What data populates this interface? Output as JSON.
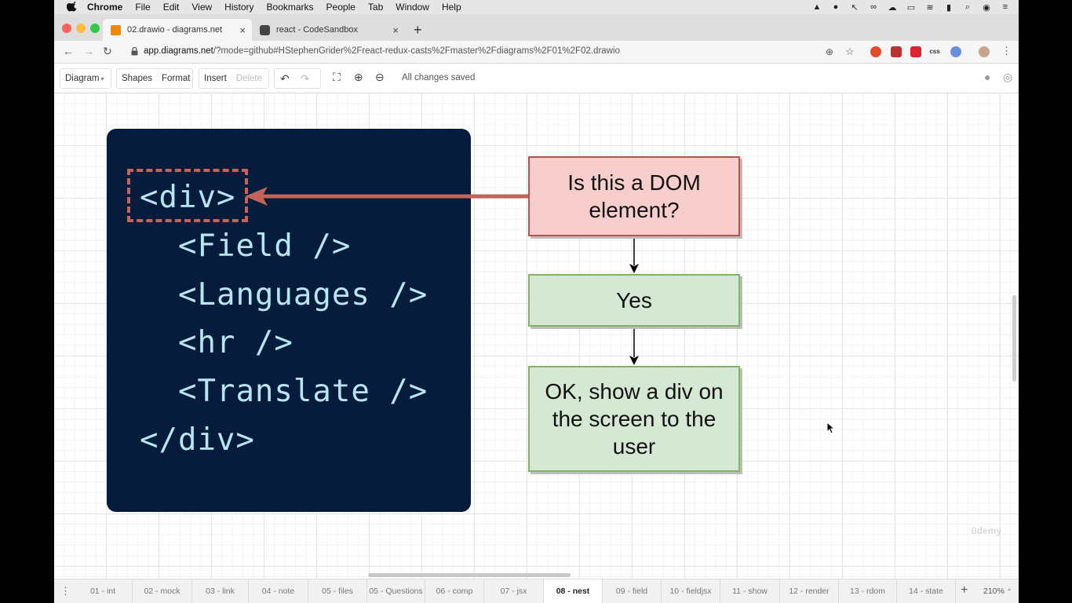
{
  "menubar": {
    "items": [
      "Chrome",
      "File",
      "Edit",
      "View",
      "History",
      "Bookmarks",
      "People",
      "Tab",
      "Window",
      "Help"
    ]
  },
  "tabs": [
    {
      "title": "02.drawio - diagrams.net",
      "close": "×"
    },
    {
      "title": "react - CodeSandbox",
      "close": "×"
    }
  ],
  "newtab": "+",
  "address": {
    "url_host": "app.diagrams.net",
    "url_rest": "/?mode=github#HStephenGrider%2Freact-redux-casts%2Fmaster%2Fdiagrams%2F01%2F02.drawio"
  },
  "toolbar": {
    "diagram": "Diagram",
    "shapes": "Shapes",
    "format": "Format",
    "insert": "Insert",
    "delete": "Delete",
    "status": "All changes saved"
  },
  "diagram": {
    "code_lines": [
      "<div>",
      "<Field />",
      "<Languages />",
      "<hr />",
      "<Translate />",
      "</div>"
    ],
    "box1": "Is this a DOM element?",
    "box2": "Yes",
    "box3": "OK, show a div on the screen to the user",
    "colors": {
      "code_bg": "#051c3c",
      "code_text": "#b7e6f2",
      "highlight": "#c26459",
      "red_fill": "#f8cecc",
      "green_fill": "#d5e8d4"
    }
  },
  "watermark": "ûdemy",
  "pages": [
    "01 - int",
    "02 - mock",
    "03 - link",
    "04 - note",
    "05 - files",
    "05 - Questions",
    "06 - comp",
    "07 - jsx",
    "08 - nest",
    "09 - field",
    "10 - fieldjsx",
    "11 - show",
    "12 - render",
    "13 - rdom",
    "14 - state"
  ],
  "active_page": "08 - nest",
  "add_page": "+",
  "zoom": "210%"
}
